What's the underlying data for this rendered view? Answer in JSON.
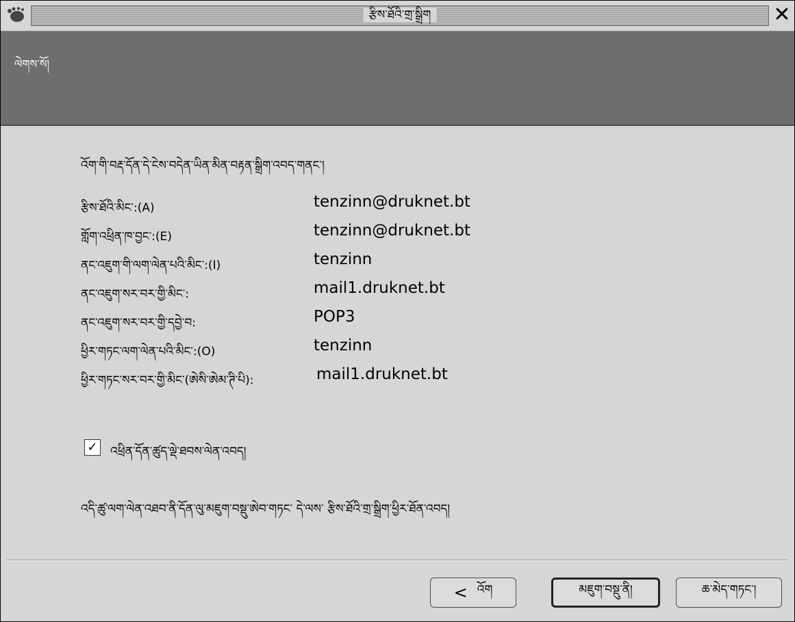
{
  "window": {
    "title": "རྩིས་ཐོའི་གྲ་སྒྲིག",
    "close_label": "✕"
  },
  "header": {
    "title": "ལེགས་སོ།"
  },
  "intro_text": "འོག་གི་བརྡ་དོན་དེ་ངེས་བདེན་ཡིན་མིན་བརྟན་སྒྲིག་འབད་གནང་།",
  "fields": [
    {
      "label": "རྩིས་ཐོའི་མིང་:(A)",
      "value": "tenzinn@druknet.bt"
    },
    {
      "label": "གློག་འཕྲིན་ཁ་བྱང་:(E)",
      "value": "tenzinn@druknet.bt"
    },
    {
      "label": "ནང་འཇུག་གི་ལག་ལེན་པའི་མིང་:(I)",
      "value": "tenzinn"
    },
    {
      "label": "ནང་འཇུག་སར་བར་གྱི་མིང་:",
      "value": "mail1.druknet.bt"
    },
    {
      "label": "ནང་འཇུག་སར་བར་གྱི་དབྱེ་བ:",
      "value": "POP3"
    },
    {
      "label": "ཕྱིར་གཏང་ལག་ལེན་པའི་མིང་:(O)",
      "value": "tenzinn"
    },
    {
      "label": "ཕྱིར་གཏང་སར་བར་གྱི་མིང་(ཨེསི་ཨེམ་ཊི་པི):",
      "value": "mail1.druknet.bt"
    }
  ],
  "checkbox": {
    "label": "འཕྲིན་དོན་ཚུད་ལྡེ་ཐབས་ལེན་འབད།",
    "checked": true,
    "mark": "✓"
  },
  "note_text": "འདི་ཚུ་ལག་ལེན་འཐབ་ནི་དོན་ལུ་མཇུག་བསྡུ་ཨེབ་གཏང་ དེ་ལས་ རྩིས་ཐོའི་གྲ་སྒྲིག་ཕྱིར་ཐོན་འབད།",
  "buttons": {
    "back_arrow": "<",
    "back_label": "འོག",
    "finish_label": "མཇུག་བསྡུ་ནི།",
    "cancel_label": "ཆ་མེད་གཏང་།"
  }
}
